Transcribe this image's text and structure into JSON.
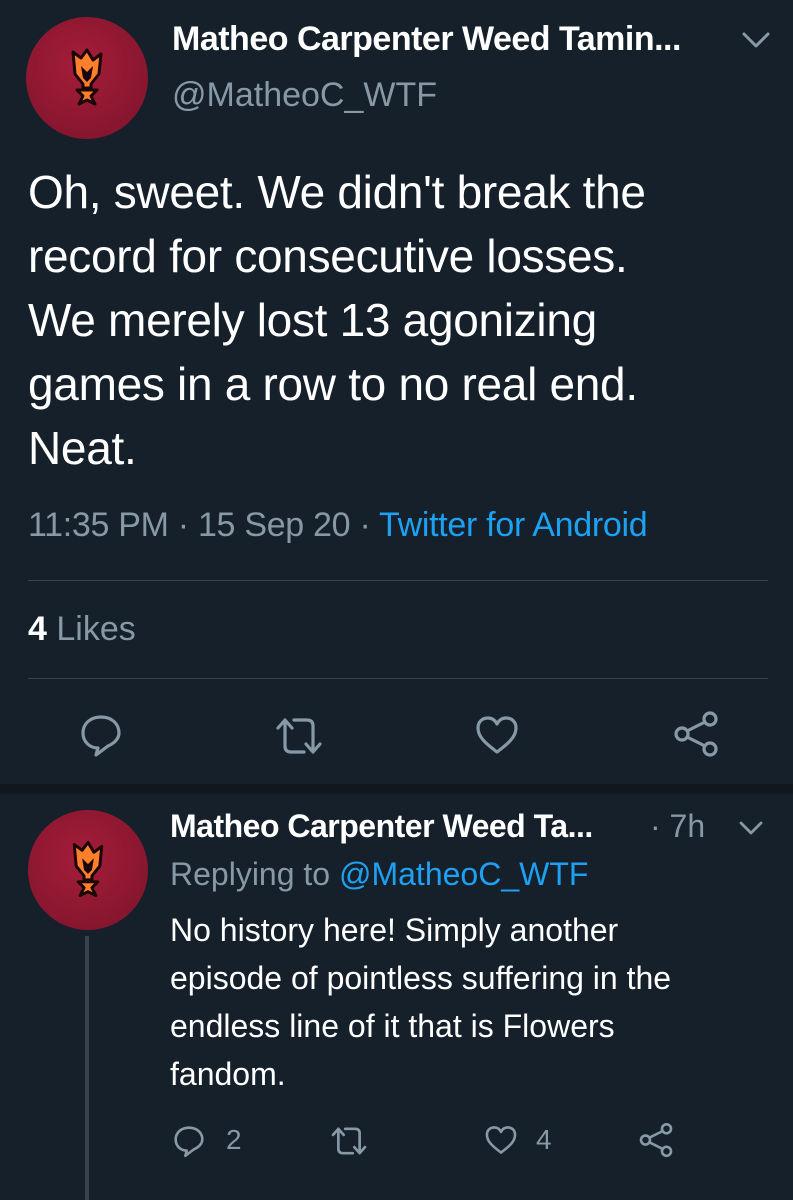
{
  "main_tweet": {
    "author": {
      "display_name": "Matheo Carpenter Weed Tamin...",
      "handle": "@MatheoC_WTF",
      "avatar_icon": "flame-torch-logo"
    },
    "text_lines": [
      "Oh, sweet. We didn't break the",
      "record for consecutive losses.",
      "We merely lost 13 agonizing",
      "games in a row to no real end.",
      "Neat."
    ],
    "time": "11:35 PM",
    "separator": "·",
    "date": "15 Sep 20",
    "source": "Twitter for Android",
    "likes_count": "4",
    "likes_label": "Likes",
    "actions": [
      "reply-icon",
      "retweet-icon",
      "like-icon",
      "share-icon"
    ]
  },
  "reply_tweet": {
    "author": {
      "display_name": "Matheo Carpenter Weed Ta...",
      "avatar_icon": "flame-torch-logo"
    },
    "time": "· 7h",
    "replying_prefix": "Replying to",
    "replying_handle": "@MatheoC_WTF",
    "text_lines": [
      "No history here! Simply another",
      "episode of pointless suffering in the",
      "endless line of it that is Flowers",
      "fandom."
    ],
    "reply_count": "2",
    "like_count": "4"
  },
  "colors": {
    "background": "#15202b",
    "text_primary": "#ffffff",
    "text_secondary": "#8899a6",
    "accent_blue": "#1da1f2",
    "divider": "#38444d",
    "avatar_red": "#8c1730",
    "logo_orange": "#ff7f2a"
  }
}
